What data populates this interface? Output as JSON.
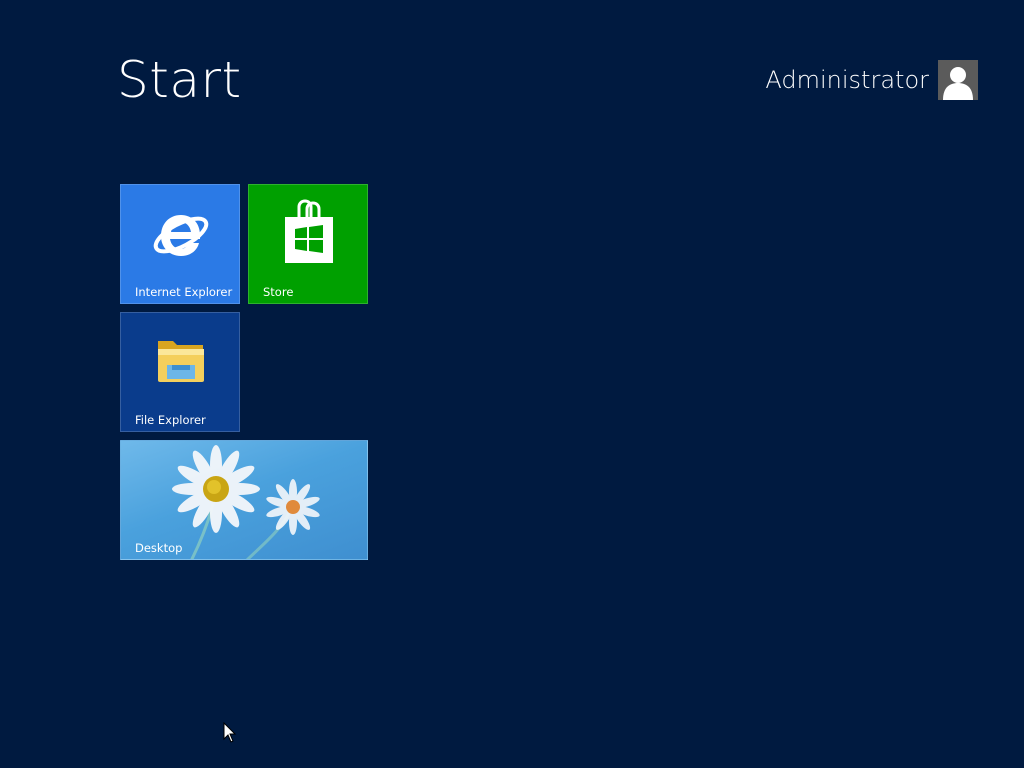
{
  "header": {
    "title": "Start",
    "user_name": "Administrator"
  },
  "tiles": [
    {
      "label": "Internet Explorer",
      "icon": "internet-explorer-icon",
      "color": "#2b7ae6"
    },
    {
      "label": "Store",
      "icon": "store-icon",
      "color": "#00a000"
    },
    {
      "label": "File Explorer",
      "icon": "file-explorer-icon",
      "color": "#0a3c8c"
    },
    {
      "label": "Desktop",
      "icon": "desktop-wallpaper",
      "color": "#4aa1dd"
    }
  ],
  "theme": {
    "background": "#001a40"
  }
}
